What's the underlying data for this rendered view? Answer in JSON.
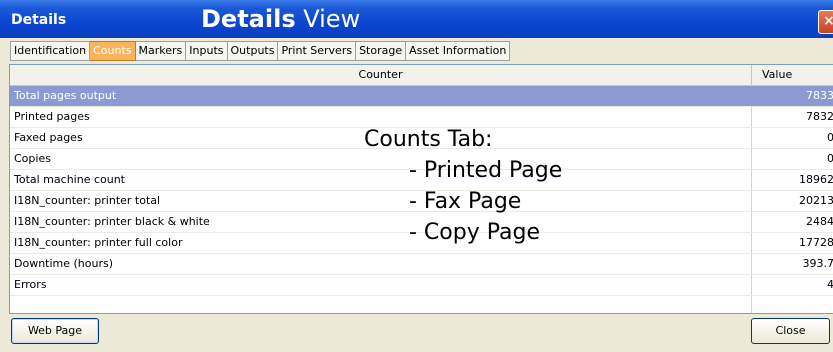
{
  "window": {
    "title": "Details",
    "heading_bold": "Details",
    "heading_rest": " View",
    "close_glyph": "×"
  },
  "tabs": [
    {
      "label": "Identification",
      "active": false
    },
    {
      "label": "Counts",
      "active": true
    },
    {
      "label": "Markers",
      "active": false
    },
    {
      "label": "Inputs",
      "active": false
    },
    {
      "label": "Outputs",
      "active": false
    },
    {
      "label": "Print Servers",
      "active": false
    },
    {
      "label": "Storage",
      "active": false
    },
    {
      "label": "Asset Information",
      "active": false
    }
  ],
  "table": {
    "columns": {
      "counter": "Counter",
      "value": "Value"
    },
    "rows": [
      {
        "counter": "Total pages output",
        "value": "7833",
        "selected": true
      },
      {
        "counter": "Printed pages",
        "value": "7832"
      },
      {
        "counter": "Faxed pages",
        "value": "0"
      },
      {
        "counter": "Copies",
        "value": "0"
      },
      {
        "counter": "Total machine count",
        "value": "18962"
      },
      {
        "counter": "I18N_counter: printer total",
        "value": "20213"
      },
      {
        "counter": "I18N_counter: printer black & white",
        "value": "2484"
      },
      {
        "counter": "I18N_counter: printer full color",
        "value": "17728"
      },
      {
        "counter": "Downtime (hours)",
        "value": "393.7"
      },
      {
        "counter": "Errors",
        "value": "4"
      }
    ]
  },
  "annotation": {
    "title": "Counts Tab:",
    "items": [
      "- Printed Page",
      "- Fax Page",
      "- Copy Page"
    ]
  },
  "buttons": {
    "web_page": "Web Page",
    "close": "Close"
  },
  "colors": {
    "titlebar": "#0a46d0",
    "active_tab": "#f7b45a",
    "selected_row": "#8c9ad2"
  }
}
